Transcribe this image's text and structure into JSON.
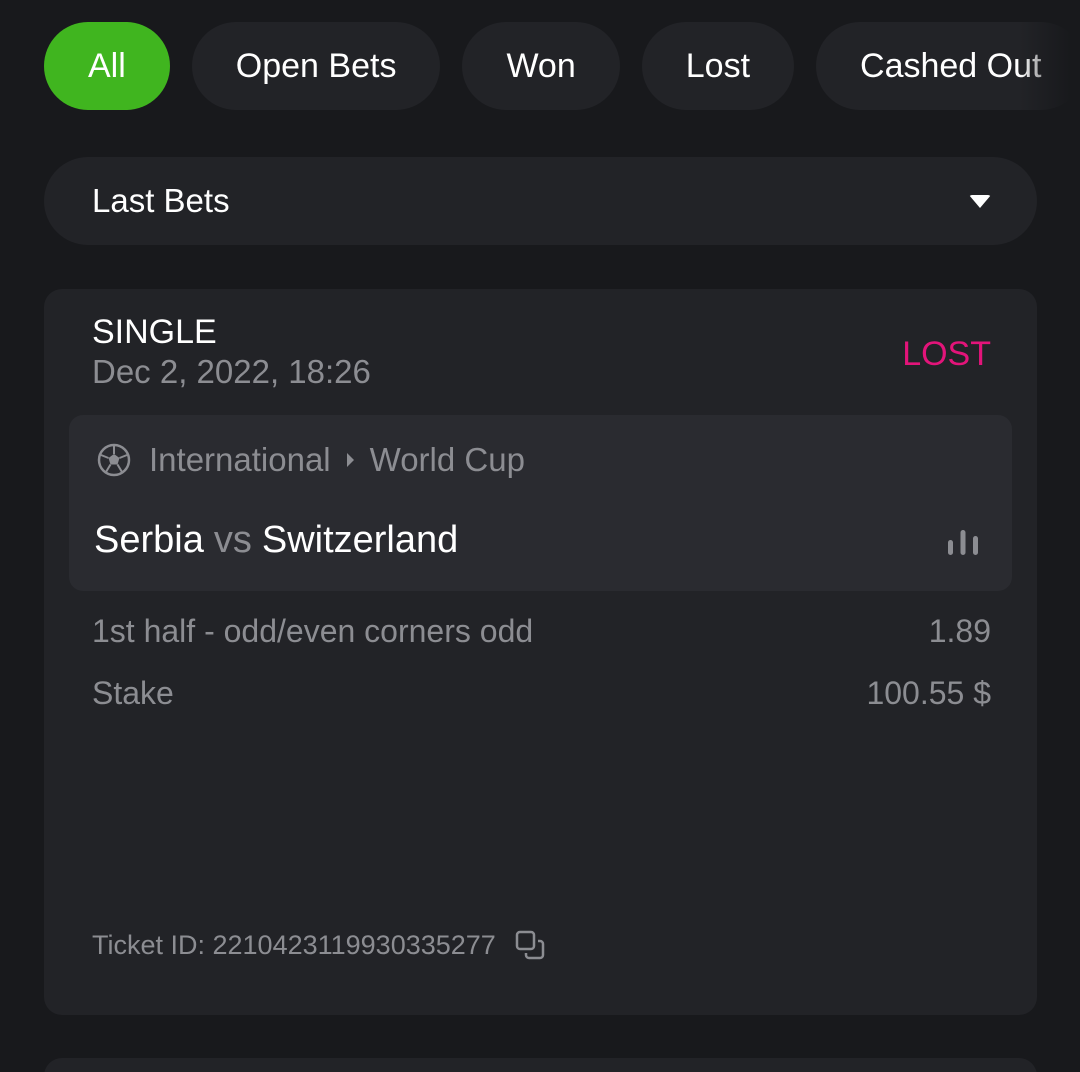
{
  "filters": {
    "tabs": [
      {
        "label": "All",
        "active": true
      },
      {
        "label": "Open Bets",
        "active": false
      },
      {
        "label": "Won",
        "active": false
      },
      {
        "label": "Lost",
        "active": false
      },
      {
        "label": "Cashed Out",
        "active": false
      }
    ]
  },
  "period_select": {
    "selected": "Last Bets",
    "icon": "caret-down-icon"
  },
  "bet": {
    "type": "SINGLE",
    "date": "Dec 2, 2022, 18:26",
    "status": "LOST",
    "status_color": "#e3147a",
    "event": {
      "sport_icon": "soccer-ball-icon",
      "category": "International",
      "league": "World Cup",
      "home_team": "Serbia",
      "vs": "vs",
      "away_team": "Switzerland",
      "stats_icon": "stats-bars-icon"
    },
    "market": "1st half - odd/even corners odd",
    "odds": "1.89",
    "stake_label": "Stake",
    "stake_value": "100.55 $",
    "ticket_label": "Ticket ID: 2210423119930335277",
    "copy_icon": "copy-icon"
  },
  "colors": {
    "accent": "#40b51f",
    "background": "#18191c",
    "card": "#222327",
    "lost": "#e3147a"
  }
}
